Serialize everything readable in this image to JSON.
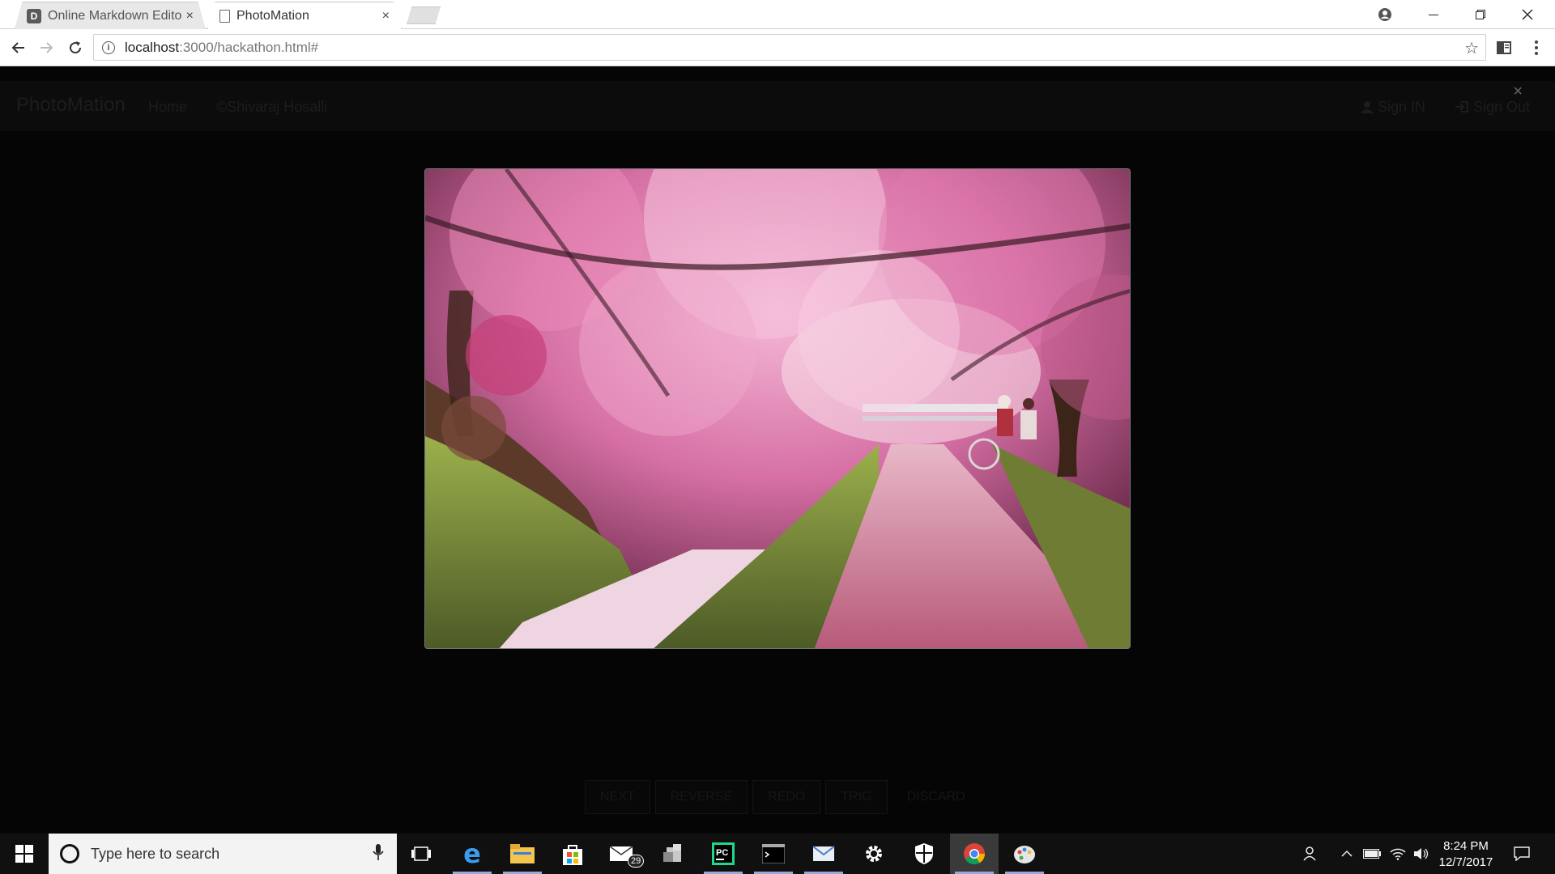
{
  "browser": {
    "tabs": [
      {
        "favicon": "D",
        "title": "Online Markdown Editor",
        "close": "×"
      },
      {
        "title": "PhotoMation",
        "close": "×"
      }
    ],
    "url_host": "localhost",
    "url_path": ":3000/hackathon.html#"
  },
  "site": {
    "brand": "PhotoMation",
    "nav": [
      "Home",
      "©Shivaraj Hosalli"
    ],
    "sign_in": "Sign IN",
    "sign_out": "Sign Out",
    "modal_close": "×",
    "buttons": [
      "NEXT",
      "REVERSE",
      "REDO",
      "TRIG",
      "DISCARD"
    ]
  },
  "taskbar": {
    "search_placeholder": "Type here to search",
    "mail_badge": "29",
    "time": "8:24 PM",
    "date": "12/7/2017"
  },
  "colors": {
    "taskbar": "#101010",
    "search_box": "#f3f3f3",
    "running_indicator": "#9aa8d8"
  }
}
